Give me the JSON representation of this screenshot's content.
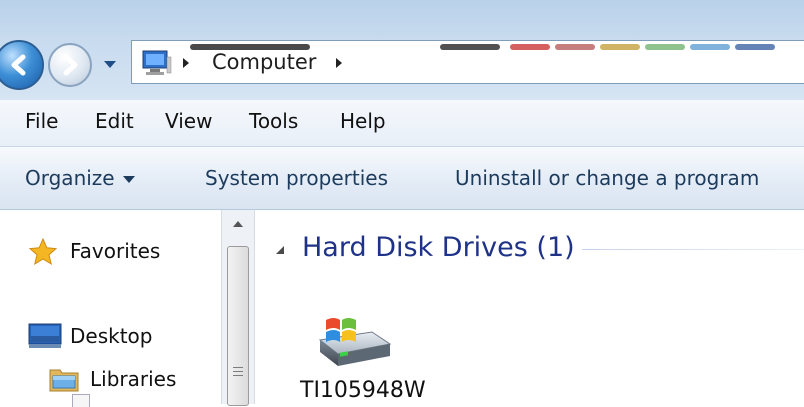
{
  "address_bar": {
    "path": "Computer",
    "icon": "computer-icon"
  },
  "menu": {
    "items": [
      "File",
      "Edit",
      "View",
      "Tools",
      "Help"
    ]
  },
  "command_bar": {
    "organize": "Organize",
    "system_properties": "System properties",
    "uninstall": "Uninstall or change a program"
  },
  "navigation": {
    "favorites": "Favorites",
    "desktop": "Desktop",
    "libraries": "Libraries"
  },
  "content": {
    "group_title": "Hard Disk Drives (1)",
    "drives": [
      {
        "label": "TI105948W",
        "icon": "windows-drive-icon"
      }
    ]
  },
  "colors": {
    "accent": "#1e3287",
    "command_text": "#1d3b5c",
    "window_frame": "#b9d1ea"
  }
}
